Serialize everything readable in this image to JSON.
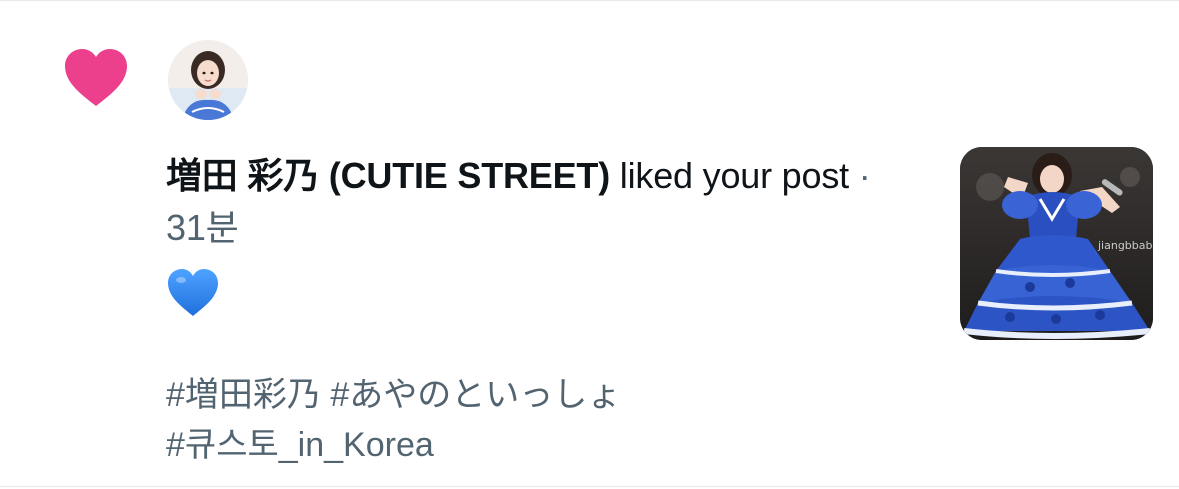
{
  "notification": {
    "actor_name": "増田 彩乃 (CUTIE STREET)",
    "action_text": " liked your post",
    "separator": " · ",
    "time": "31분",
    "post_emoji": "blue-heart",
    "hashtags_line1": "#増田彩乃 #あやのといっしょ",
    "hashtags_line2": "#큐스토_in_Korea",
    "thumbnail_watermark": "jiangbbabb"
  },
  "icons": {
    "like": "heart-icon",
    "emoji": "blue-heart-emoji"
  },
  "colors": {
    "like_pink": "#ec3f8c",
    "emoji_blue": "#2e7fe8",
    "secondary_text": "#536471",
    "primary_text": "#0f1419"
  }
}
